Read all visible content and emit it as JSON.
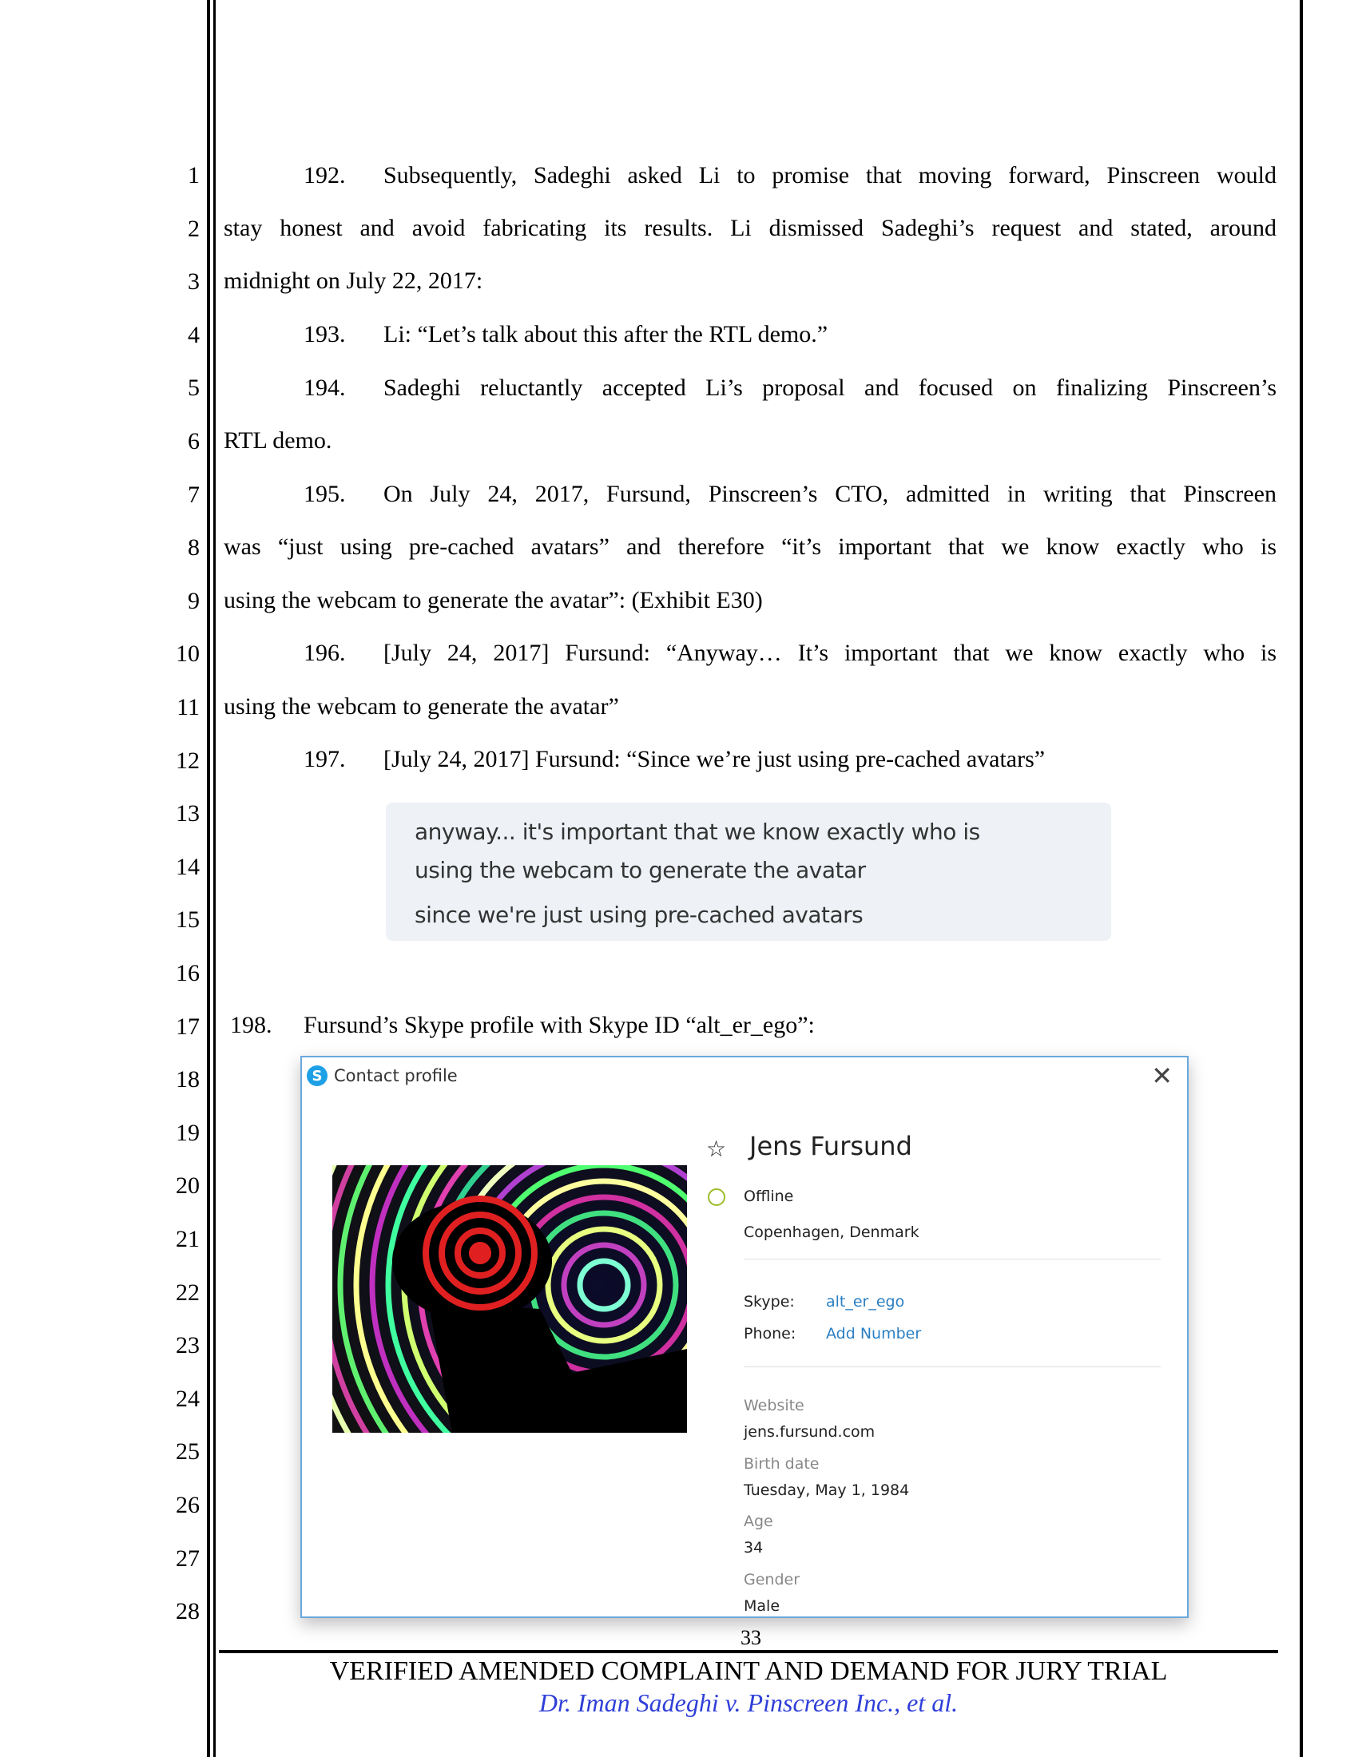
{
  "line_numbers": [
    "1",
    "2",
    "3",
    "4",
    "5",
    "6",
    "7",
    "8",
    "9",
    "10",
    "11",
    "12",
    "13",
    "14",
    "15",
    "16",
    "17",
    "18",
    "19",
    "20",
    "21",
    "22",
    "23",
    "24",
    "25",
    "26",
    "27",
    "28"
  ],
  "body": {
    "p192_num": "192.",
    "p192_l1": "Subsequently, Sadeghi asked Li to promise that moving forward, Pinscreen would",
    "p192_l2": "stay honest and avoid fabricating its results. Li dismissed Sadeghi’s request and stated, around",
    "p192_l3": "midnight on July 22, 2017:",
    "p193_num": "193.",
    "p193_l1": "Li: “Let’s talk about this after the RTL demo.”",
    "p194_num": "194.",
    "p194_l1": "Sadeghi reluctantly accepted Li’s proposal and focused on finalizing Pinscreen’s",
    "p194_l2": "RTL demo.",
    "p195_num": "195.",
    "p195_l1": "On July 24, 2017, Fursund, Pinscreen’s CTO, admitted in writing that Pinscreen",
    "p195_l2": "was “just using pre-cached avatars” and therefore “it’s important that we know exactly who is",
    "p195_l3": "using the webcam to generate the avatar”: (Exhibit E30)",
    "p196_num": "196.",
    "p196_l1": "[July 24, 2017] Fursund: “Anyway… It’s important that we know exactly who is",
    "p196_l2": "using the webcam to generate the avatar”",
    "p197_num": "197.",
    "p197_l1": "[July 24, 2017] Fursund: “Since we’re just using pre-cached avatars”",
    "p198_num": "198.",
    "p198_l1": "Fursund’s Skype profile with Skype ID “alt_er_ego”:"
  },
  "chat_excerpt": {
    "messages": [
      "anyway... it's important that we know exactly who is",
      "using the webcam to generate the avatar",
      "since we're just using pre-cached avatars"
    ]
  },
  "skype_profile": {
    "window_title": "Contact profile",
    "name": "Jens Fursund",
    "status": "Offline",
    "location": "Copenhagen, Denmark",
    "skype_label": "Skype:",
    "skype_id": "alt_er_ego",
    "phone_label": "Phone:",
    "phone_value": "Add Number",
    "website_label": "Website",
    "website_value": "jens.fursund.com",
    "birth_label": "Birth date",
    "birth_value": "Tuesday, May 1, 1984",
    "age_label": "Age",
    "age_value": "34",
    "gender_label": "Gender",
    "gender_value": "Male",
    "accent_color": "#2b7fc2",
    "status_color": "#9cbd28"
  },
  "footer": {
    "page_number": "33",
    "title": "VERIFIED AMENDED COMPLAINT AND DEMAND FOR JURY TRIAL",
    "case_caption": "Dr. Iman Sadeghi v. Pinscreen Inc., et al.",
    "caption_color": "#2f3fd8"
  }
}
